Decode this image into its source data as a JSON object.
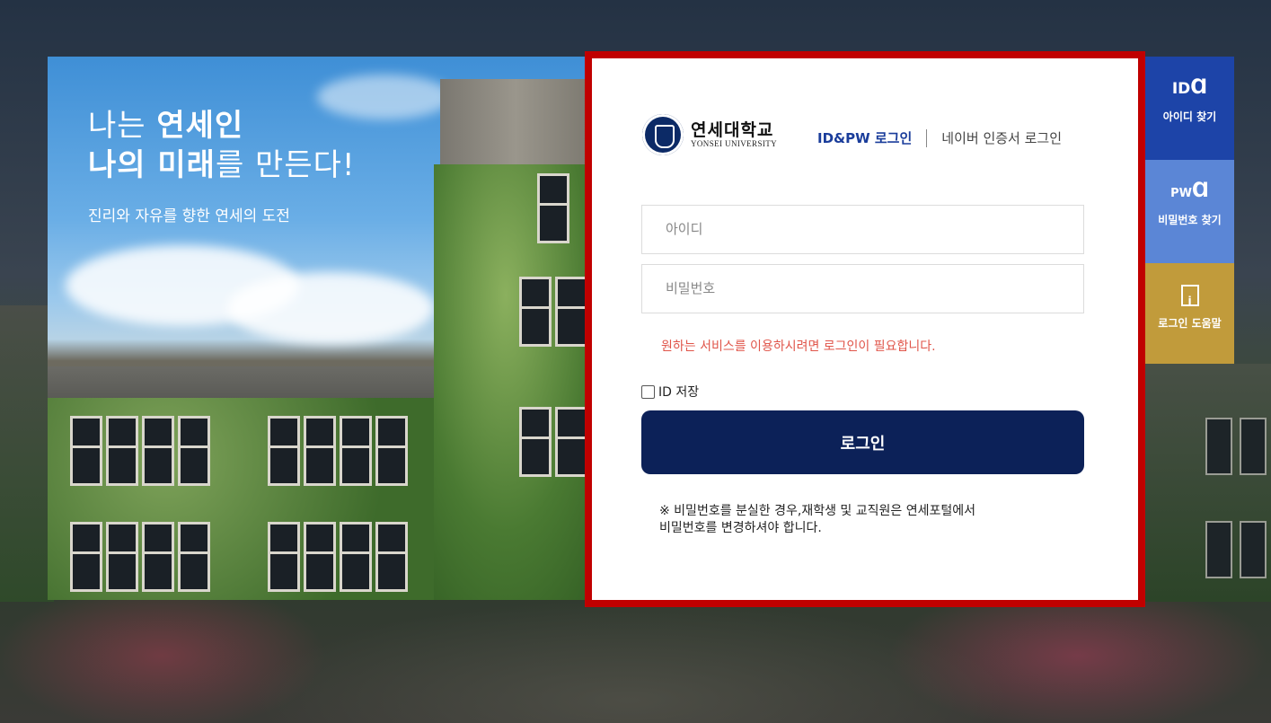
{
  "hero": {
    "line1_plain": "나는 ",
    "line1_bold": "연세인",
    "line2_bold": "나의 미래",
    "line2_plain": "를 만든다!",
    "subtitle": "진리와 자유를 향한 연세의 도전"
  },
  "logo": {
    "name_kr": "연세대학교",
    "name_en": "YONSEI UNIVERSITY"
  },
  "tabs": {
    "active": "ID&PW 로그인",
    "other": "네이버 인증서 로그인"
  },
  "form": {
    "id_placeholder": "아이디",
    "pw_placeholder": "비밀번호",
    "notice": "원하는 서비스를 이용하시려면 로그인이 필요합니다.",
    "save_id_label": "ID 저장",
    "login_button": "로그인",
    "footnote_line1": "※ 비밀번호를 분실한 경우,재학생 및 교직원은 연세포털에서",
    "footnote_line2": "비밀번호를 변경하셔야 합니다."
  },
  "quick_menu": {
    "id_icon": "ID",
    "id_label": "아이디 찾기",
    "pw_icon": "PW",
    "pw_label": "비밀번호 찾기",
    "help_label": "로그인 도움말"
  },
  "colors": {
    "highlight_border": "#c00000",
    "login_button": "#0c2158",
    "active_tab": "#1a3d9b",
    "notice": "#e0554a",
    "qm_id": "#1d44a8",
    "qm_pw": "#5b86d6",
    "qm_help": "#c19b3b"
  },
  "icons": {
    "id_find": "id-search-icon",
    "pw_find": "pw-search-icon",
    "help": "document-info-icon",
    "logo": "yonsei-seal-icon"
  }
}
